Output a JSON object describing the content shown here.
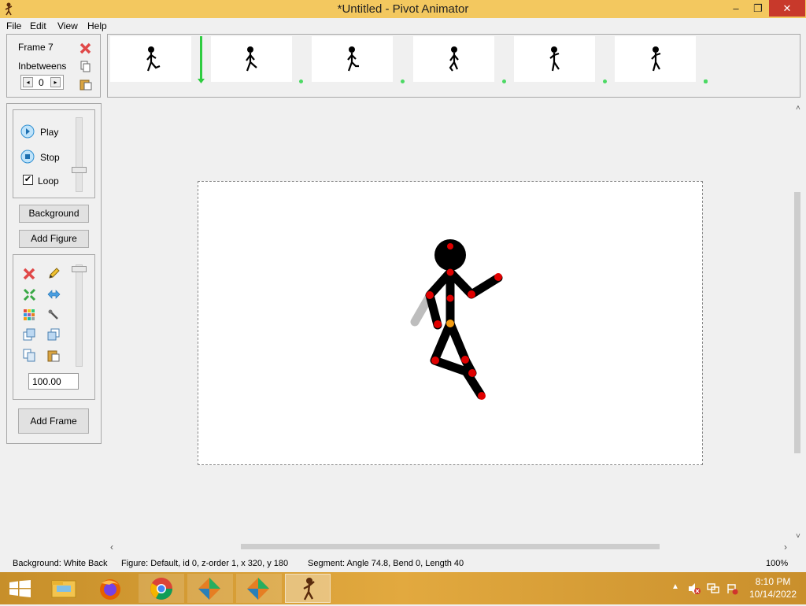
{
  "window": {
    "title": "*Untitled - Pivot Animator",
    "minimize": "–",
    "restore": "❐",
    "close": "✕"
  },
  "menu": [
    "File",
    "Edit",
    "View",
    "Help"
  ],
  "frame_panel": {
    "frame_label": "Frame 7",
    "inbetweens_label": "Inbetweens",
    "inbetweens_value": "0"
  },
  "playback": {
    "play": "Play",
    "stop": "Stop",
    "loop": "Loop",
    "loop_checked": true
  },
  "buttons": {
    "background": "Background",
    "add_figure": "Add Figure",
    "add_frame": "Add Frame"
  },
  "tools": {
    "scale_value": "100.00"
  },
  "status": {
    "background": "Background: White Back",
    "figure": "Figure: Default,  id 0,  z-order 1,  x 320, y 180",
    "segment": "Segment: Angle 74.8,  Bend 0,  Length 40",
    "zoom": "100%"
  },
  "clock": {
    "time": "8:10 PM",
    "date": "10/14/2022"
  },
  "colors": {
    "titlebar": "#f3c85f",
    "taskbar": "#d89e35",
    "joint": "#e00000",
    "origin_joint": "#f39c12",
    "timeline_marker": "#2ecc40"
  }
}
